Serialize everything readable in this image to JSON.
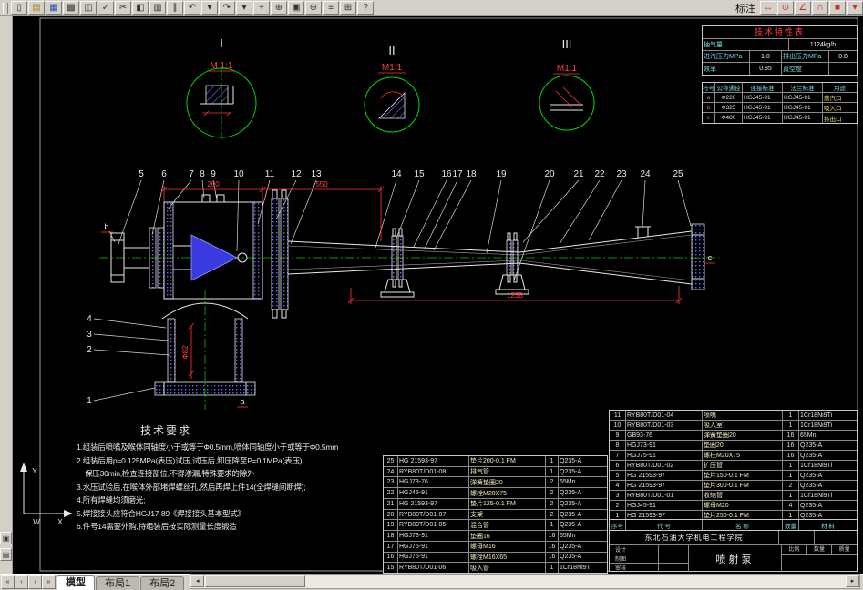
{
  "colors": {
    "canvas_bg": "#000000",
    "line_white": "#e8e8e8",
    "centerline_green": "#00c800",
    "dimension_red": "#ff3333",
    "hatch_blue": "#6868ff",
    "ui_gray": "#d4d0c8",
    "table_label_cyan": "#7fd8d8",
    "title_red": "#ff4040"
  },
  "toolbar": {
    "left_icons": [
      {
        "name": "new-icon",
        "glyph": "▯"
      },
      {
        "name": "open-icon",
        "glyph": "▤"
      },
      {
        "name": "save-icon",
        "glyph": "▦"
      },
      {
        "name": "plot-icon",
        "glyph": "▩"
      },
      {
        "name": "plot-preview-icon",
        "glyph": "◫"
      },
      {
        "name": "spell-icon",
        "glyph": "✓"
      },
      {
        "name": "cut-icon",
        "glyph": "✂"
      },
      {
        "name": "copy-icon",
        "glyph": "◧"
      },
      {
        "name": "paste-icon",
        "glyph": "▥"
      },
      {
        "name": "match-properties-icon",
        "glyph": "∥"
      },
      {
        "name": "undo-icon",
        "glyph": "↶"
      },
      {
        "name": "undo-dropdown-icon",
        "glyph": "▾"
      },
      {
        "name": "redo-icon",
        "glyph": "↷"
      },
      {
        "name": "redo-dropdown-icon",
        "glyph": "▾"
      },
      {
        "name": "pan-icon",
        "glyph": "+"
      },
      {
        "name": "zoom-realtime-icon",
        "glyph": "⊕"
      },
      {
        "name": "zoom-window-icon",
        "glyph": "▣"
      },
      {
        "name": "zoom-previous-icon",
        "glyph": "⊖"
      },
      {
        "name": "properties-icon",
        "glyph": "≡"
      },
      {
        "name": "design-center-icon",
        "glyph": "⊞"
      },
      {
        "name": "help-icon",
        "glyph": "?"
      }
    ],
    "dim_label": "标注",
    "right_icons": [
      {
        "name": "dim-linear-icon",
        "glyph": "↔"
      },
      {
        "name": "dim-radius-icon",
        "glyph": "⊙"
      },
      {
        "name": "dim-angular-icon",
        "glyph": "∠"
      },
      {
        "name": "dim-arc-icon",
        "glyph": "∩"
      },
      {
        "name": "color-swatch-icon",
        "glyph": "■"
      },
      {
        "name": "dropdown-icon",
        "glyph": "▾"
      }
    ]
  },
  "dock": {
    "buttons": [
      {
        "name": "dock-tool-button-1",
        "glyph": "▣"
      },
      {
        "name": "dock-tool-button-2",
        "glyph": "▤"
      }
    ]
  },
  "drawing": {
    "details": [
      {
        "label": "I",
        "scale": "M 1:1"
      },
      {
        "label": "II",
        "scale": "M1:1"
      },
      {
        "label": "III",
        "scale": "M1:1"
      }
    ],
    "callouts_top": [
      "5",
      "6",
      "7",
      "8",
      "9",
      "10",
      "11",
      "12",
      "13",
      "14",
      "15",
      "16",
      "17",
      "18",
      "19",
      "20",
      "21",
      "22",
      "23",
      "24",
      "25"
    ],
    "callouts_left": [
      "4",
      "3",
      "2",
      "1"
    ],
    "ports": {
      "steam": "b",
      "suction": "a",
      "discharge": "c"
    },
    "dims": {
      "top_left": "200",
      "top_right": "550",
      "overall": "1235",
      "pipe_dia": "Ф82"
    },
    "ucs": {
      "x": "X",
      "y": "Y",
      "w": "W"
    },
    "tech_req": {
      "title": "技术要求",
      "lines": [
        "1.组装后喷嘴及喉体同轴度小于或等于Ф0.5mm,喷体同轴度小于或等于Ф0.5mm",
        "2.组装后用p=0.125MPa(表压)试压,试压后,卸压降至P=0.1MPa(表压),",
        "保压30min,检查连接部位,不得渗漏,特殊要求的除外",
        "3.水压试验后,在喉体外部堵焊螺丝孔,然后再焊上件14(全焊缝间断焊);",
        "4.所有焊缝均须磨光;",
        "5.焊接接头应符合HGJ17-89《焊接接头基本型式》",
        "6.件号14需要外购,待组装后按实际测量长度锻造"
      ]
    }
  },
  "spec_table": {
    "title": "技术特性表",
    "r1_label": "抽气量",
    "r1_value": "1124kg/h",
    "r2c1": "进汽压力MPa",
    "r2c2": "1.0",
    "r2c3": "排出压力MPa",
    "r2c4": "0.8",
    "r3c1": "效率",
    "r3c2": "0.85",
    "r3c3": "真空度",
    "r3c4": ""
  },
  "port_table": {
    "header": [
      "符号",
      "公称通径",
      "连接标准",
      "法兰标准",
      "用途"
    ],
    "rows": [
      [
        "a",
        "Ф220",
        "HGJ45-91",
        "HGJ45-91",
        "蒸汽口"
      ],
      [
        "b",
        "Ф325",
        "HGJ45-91",
        "HGJ45-91",
        "吸入口"
      ],
      [
        "c",
        "Ф480",
        "HGJ45-91",
        "HGJ45-91",
        "排出口"
      ]
    ]
  },
  "bom_mid": {
    "rows": [
      [
        "25",
        "HG 21593-97",
        "垫片200-0.1 FM",
        "1",
        "Q235-A"
      ],
      [
        "24",
        "RYB80T/D01-08",
        "排气管",
        "1",
        "Q235-A"
      ],
      [
        "23",
        "HGJ73-76",
        "弹簧垫圈20",
        "2",
        "65Mn"
      ],
      [
        "22",
        "HGJ45-91",
        "螺栓M20X75",
        "2",
        "Q235-A"
      ],
      [
        "21",
        "HG 21593-97",
        "垫片125-0.1 FM",
        "2",
        "Q235-A"
      ],
      [
        "20",
        "RYB80T/D01-07",
        "支架",
        "2",
        "Q235-A"
      ],
      [
        "19",
        "RYB80T/D01-05",
        "混合管",
        "1",
        "Q235-A"
      ],
      [
        "18",
        "HGJ73-91",
        "垫圈16",
        "16",
        "65Mn"
      ],
      [
        "17",
        "HGJ75-91",
        "螺母M16",
        "16",
        "Q235-A"
      ],
      [
        "16",
        "HGJ75-91",
        "螺栓M16X65",
        "16",
        "Q235-A"
      ],
      [
        "15",
        "RYB80T/D01-06",
        "吸入管",
        "1",
        "1Cr18Ni9Ti"
      ]
    ]
  },
  "bom_right": {
    "header": [
      "序号",
      "代  号",
      "名  称",
      "数量",
      "材  料"
    ],
    "rows": [
      [
        "11",
        "RYB80T/D01-04",
        "喷嘴",
        "1",
        "1Cr18Ni9Ti"
      ],
      [
        "10",
        "RYB80T/D01-03",
        "吸入室",
        "1",
        "1Cr18Ni9Ti"
      ],
      [
        "9",
        "GB93-76",
        "弹簧垫圈20",
        "16",
        "65Mn"
      ],
      [
        "8",
        "HGJ73-91",
        "垫圈20",
        "16",
        "Q235-A"
      ],
      [
        "7",
        "HGJ75-91",
        "螺柱M20X75",
        "16",
        "Q235-A"
      ],
      [
        "6",
        "RYB80T/D01-02",
        "扩压管",
        "1",
        "1Cr18Ni9Ti"
      ],
      [
        "5",
        "HG 21593-97",
        "垫片150-0.1 FM",
        "1",
        "Q235-A"
      ],
      [
        "4",
        "HG 21593-97",
        "垫片300-0.1 FM",
        "2",
        "Q235-A"
      ],
      [
        "3",
        "RYB80T/D01-01",
        "收缩管",
        "1",
        "1Cr18Ni9Ti"
      ],
      [
        "2",
        "HGJ45-91",
        "螺母M20",
        "4",
        "Q235-A"
      ],
      [
        "1",
        "HG 21593-97",
        "垫片250-0.1 FM",
        "1",
        "Q235-A"
      ]
    ]
  },
  "title_block": {
    "school": "东北石油大学机电工程学院",
    "part_name": "喷射泵",
    "left_rows": [
      "设计",
      "制图",
      "审核"
    ],
    "right_labels": [
      "比例",
      "数量",
      "质量"
    ]
  },
  "tabs": {
    "nav": [
      "«",
      "‹",
      "›",
      "»"
    ],
    "items": [
      {
        "label": "模型"
      },
      {
        "label": "布局1"
      },
      {
        "label": "布局2"
      }
    ],
    "scroll": {
      "left": "◂",
      "right": "▸"
    }
  }
}
